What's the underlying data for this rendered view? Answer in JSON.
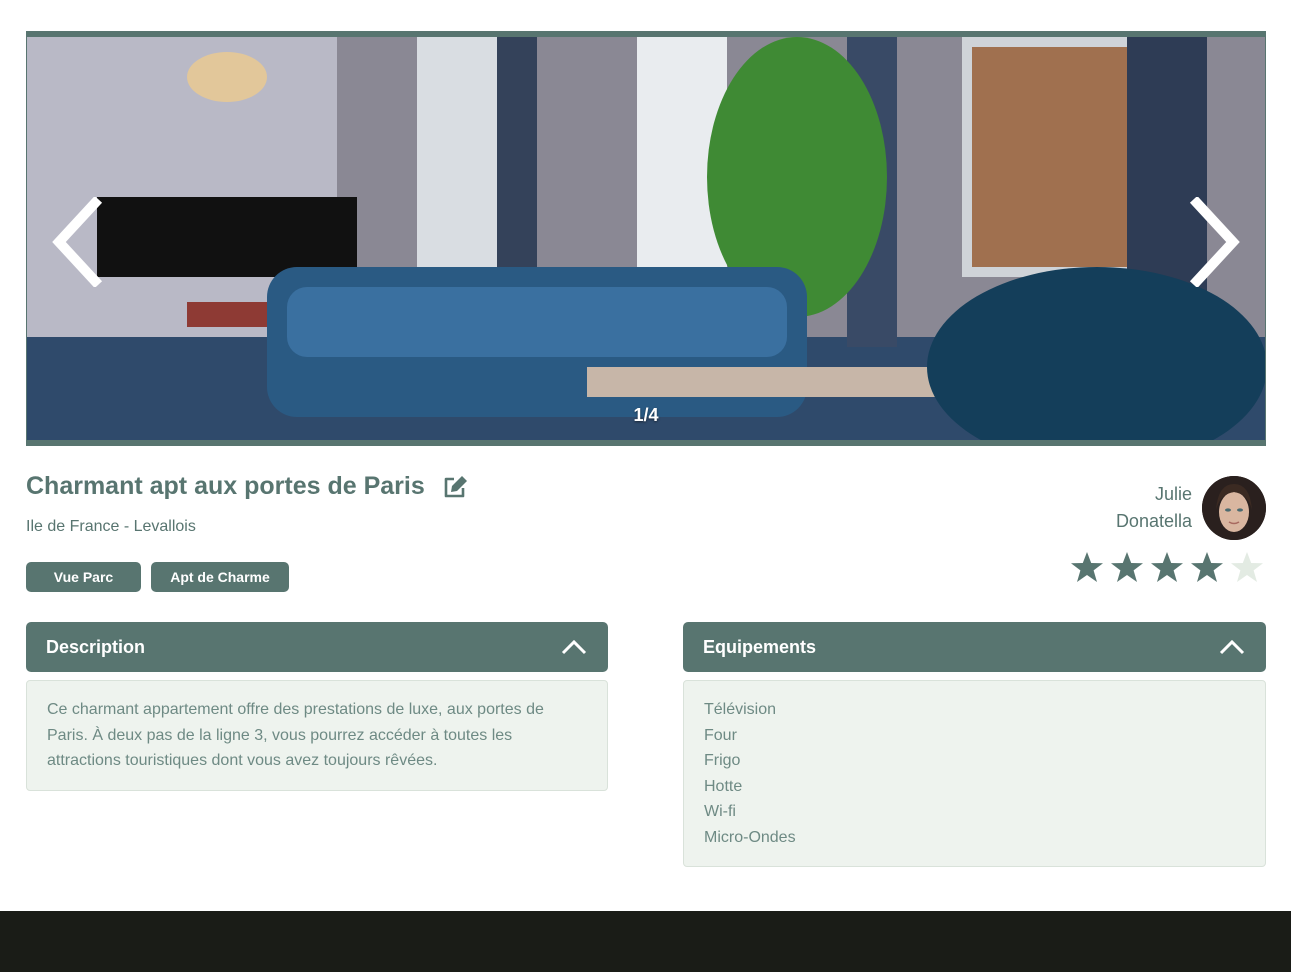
{
  "carousel": {
    "counter": "1/4",
    "prev_icon": "chevron-left-icon",
    "next_icon": "chevron-right-icon",
    "image_alt": "living room with piano and blue sofa"
  },
  "listing": {
    "title": "Charmant apt aux portes de Paris",
    "location": "Ile de France - Levallois",
    "tags": [
      "Vue Parc",
      "Apt de Charme"
    ]
  },
  "host": {
    "first_name": "Julie",
    "last_name": "Donatella"
  },
  "rating": {
    "value": 4,
    "max": 5
  },
  "description": {
    "header": "Description",
    "text": "Ce charmant appartement offre des prestations de luxe, aux portes de Paris. À deux pas de la ligne 3, vous pourrez accéder à toutes les attractions touristiques dont vous avez toujours rêvées."
  },
  "equipments": {
    "header": "Equipements",
    "items": [
      "Télévision",
      "Four",
      "Frigo",
      "Hotte",
      "Wi-fi",
      "Micro-Ondes"
    ]
  },
  "colors": {
    "primary": "#587570",
    "panel_bg": "#eef3ee",
    "star_empty": "#e3ebe3",
    "footer": "#1a1c17"
  }
}
